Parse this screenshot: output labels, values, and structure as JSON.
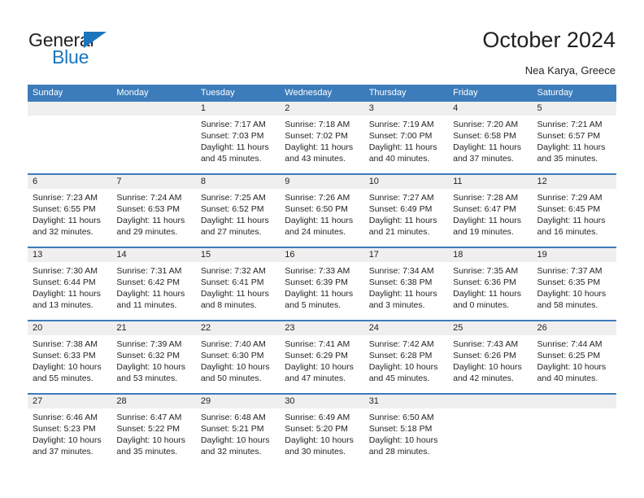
{
  "brand": {
    "name_top": "General",
    "name_bottom": "Blue",
    "accent_color": "#1b75bc"
  },
  "header": {
    "title": "October 2024",
    "subtitle": "Nea Karya, Greece"
  },
  "calendar": {
    "header_color": "#3d7cbb",
    "daynum_strip_color": "#efefef",
    "weekday_headers": [
      "Sunday",
      "Monday",
      "Tuesday",
      "Wednesday",
      "Thursday",
      "Friday",
      "Saturday"
    ],
    "weeks": [
      [
        {
          "day": "",
          "empty": true
        },
        {
          "day": "",
          "empty": true
        },
        {
          "day": "1",
          "sunrise": "Sunrise: 7:17 AM",
          "sunset": "Sunset: 7:03 PM",
          "daylight_1": "Daylight: 11 hours",
          "daylight_2": "and 45 minutes."
        },
        {
          "day": "2",
          "sunrise": "Sunrise: 7:18 AM",
          "sunset": "Sunset: 7:02 PM",
          "daylight_1": "Daylight: 11 hours",
          "daylight_2": "and 43 minutes."
        },
        {
          "day": "3",
          "sunrise": "Sunrise: 7:19 AM",
          "sunset": "Sunset: 7:00 PM",
          "daylight_1": "Daylight: 11 hours",
          "daylight_2": "and 40 minutes."
        },
        {
          "day": "4",
          "sunrise": "Sunrise: 7:20 AM",
          "sunset": "Sunset: 6:58 PM",
          "daylight_1": "Daylight: 11 hours",
          "daylight_2": "and 37 minutes."
        },
        {
          "day": "5",
          "sunrise": "Sunrise: 7:21 AM",
          "sunset": "Sunset: 6:57 PM",
          "daylight_1": "Daylight: 11 hours",
          "daylight_2": "and 35 minutes."
        }
      ],
      [
        {
          "day": "6",
          "sunrise": "Sunrise: 7:23 AM",
          "sunset": "Sunset: 6:55 PM",
          "daylight_1": "Daylight: 11 hours",
          "daylight_2": "and 32 minutes."
        },
        {
          "day": "7",
          "sunrise": "Sunrise: 7:24 AM",
          "sunset": "Sunset: 6:53 PM",
          "daylight_1": "Daylight: 11 hours",
          "daylight_2": "and 29 minutes."
        },
        {
          "day": "8",
          "sunrise": "Sunrise: 7:25 AM",
          "sunset": "Sunset: 6:52 PM",
          "daylight_1": "Daylight: 11 hours",
          "daylight_2": "and 27 minutes."
        },
        {
          "day": "9",
          "sunrise": "Sunrise: 7:26 AM",
          "sunset": "Sunset: 6:50 PM",
          "daylight_1": "Daylight: 11 hours",
          "daylight_2": "and 24 minutes."
        },
        {
          "day": "10",
          "sunrise": "Sunrise: 7:27 AM",
          "sunset": "Sunset: 6:49 PM",
          "daylight_1": "Daylight: 11 hours",
          "daylight_2": "and 21 minutes."
        },
        {
          "day": "11",
          "sunrise": "Sunrise: 7:28 AM",
          "sunset": "Sunset: 6:47 PM",
          "daylight_1": "Daylight: 11 hours",
          "daylight_2": "and 19 minutes."
        },
        {
          "day": "12",
          "sunrise": "Sunrise: 7:29 AM",
          "sunset": "Sunset: 6:45 PM",
          "daylight_1": "Daylight: 11 hours",
          "daylight_2": "and 16 minutes."
        }
      ],
      [
        {
          "day": "13",
          "sunrise": "Sunrise: 7:30 AM",
          "sunset": "Sunset: 6:44 PM",
          "daylight_1": "Daylight: 11 hours",
          "daylight_2": "and 13 minutes."
        },
        {
          "day": "14",
          "sunrise": "Sunrise: 7:31 AM",
          "sunset": "Sunset: 6:42 PM",
          "daylight_1": "Daylight: 11 hours",
          "daylight_2": "and 11 minutes."
        },
        {
          "day": "15",
          "sunrise": "Sunrise: 7:32 AM",
          "sunset": "Sunset: 6:41 PM",
          "daylight_1": "Daylight: 11 hours",
          "daylight_2": "and 8 minutes."
        },
        {
          "day": "16",
          "sunrise": "Sunrise: 7:33 AM",
          "sunset": "Sunset: 6:39 PM",
          "daylight_1": "Daylight: 11 hours",
          "daylight_2": "and 5 minutes."
        },
        {
          "day": "17",
          "sunrise": "Sunrise: 7:34 AM",
          "sunset": "Sunset: 6:38 PM",
          "daylight_1": "Daylight: 11 hours",
          "daylight_2": "and 3 minutes."
        },
        {
          "day": "18",
          "sunrise": "Sunrise: 7:35 AM",
          "sunset": "Sunset: 6:36 PM",
          "daylight_1": "Daylight: 11 hours",
          "daylight_2": "and 0 minutes."
        },
        {
          "day": "19",
          "sunrise": "Sunrise: 7:37 AM",
          "sunset": "Sunset: 6:35 PM",
          "daylight_1": "Daylight: 10 hours",
          "daylight_2": "and 58 minutes."
        }
      ],
      [
        {
          "day": "20",
          "sunrise": "Sunrise: 7:38 AM",
          "sunset": "Sunset: 6:33 PM",
          "daylight_1": "Daylight: 10 hours",
          "daylight_2": "and 55 minutes."
        },
        {
          "day": "21",
          "sunrise": "Sunrise: 7:39 AM",
          "sunset": "Sunset: 6:32 PM",
          "daylight_1": "Daylight: 10 hours",
          "daylight_2": "and 53 minutes."
        },
        {
          "day": "22",
          "sunrise": "Sunrise: 7:40 AM",
          "sunset": "Sunset: 6:30 PM",
          "daylight_1": "Daylight: 10 hours",
          "daylight_2": "and 50 minutes."
        },
        {
          "day": "23",
          "sunrise": "Sunrise: 7:41 AM",
          "sunset": "Sunset: 6:29 PM",
          "daylight_1": "Daylight: 10 hours",
          "daylight_2": "and 47 minutes."
        },
        {
          "day": "24",
          "sunrise": "Sunrise: 7:42 AM",
          "sunset": "Sunset: 6:28 PM",
          "daylight_1": "Daylight: 10 hours",
          "daylight_2": "and 45 minutes."
        },
        {
          "day": "25",
          "sunrise": "Sunrise: 7:43 AM",
          "sunset": "Sunset: 6:26 PM",
          "daylight_1": "Daylight: 10 hours",
          "daylight_2": "and 42 minutes."
        },
        {
          "day": "26",
          "sunrise": "Sunrise: 7:44 AM",
          "sunset": "Sunset: 6:25 PM",
          "daylight_1": "Daylight: 10 hours",
          "daylight_2": "and 40 minutes."
        }
      ],
      [
        {
          "day": "27",
          "sunrise": "Sunrise: 6:46 AM",
          "sunset": "Sunset: 5:23 PM",
          "daylight_1": "Daylight: 10 hours",
          "daylight_2": "and 37 minutes."
        },
        {
          "day": "28",
          "sunrise": "Sunrise: 6:47 AM",
          "sunset": "Sunset: 5:22 PM",
          "daylight_1": "Daylight: 10 hours",
          "daylight_2": "and 35 minutes."
        },
        {
          "day": "29",
          "sunrise": "Sunrise: 6:48 AM",
          "sunset": "Sunset: 5:21 PM",
          "daylight_1": "Daylight: 10 hours",
          "daylight_2": "and 32 minutes."
        },
        {
          "day": "30",
          "sunrise": "Sunrise: 6:49 AM",
          "sunset": "Sunset: 5:20 PM",
          "daylight_1": "Daylight: 10 hours",
          "daylight_2": "and 30 minutes."
        },
        {
          "day": "31",
          "sunrise": "Sunrise: 6:50 AM",
          "sunset": "Sunset: 5:18 PM",
          "daylight_1": "Daylight: 10 hours",
          "daylight_2": "and 28 minutes."
        },
        {
          "day": "",
          "empty": true
        },
        {
          "day": "",
          "empty": true
        }
      ]
    ]
  }
}
